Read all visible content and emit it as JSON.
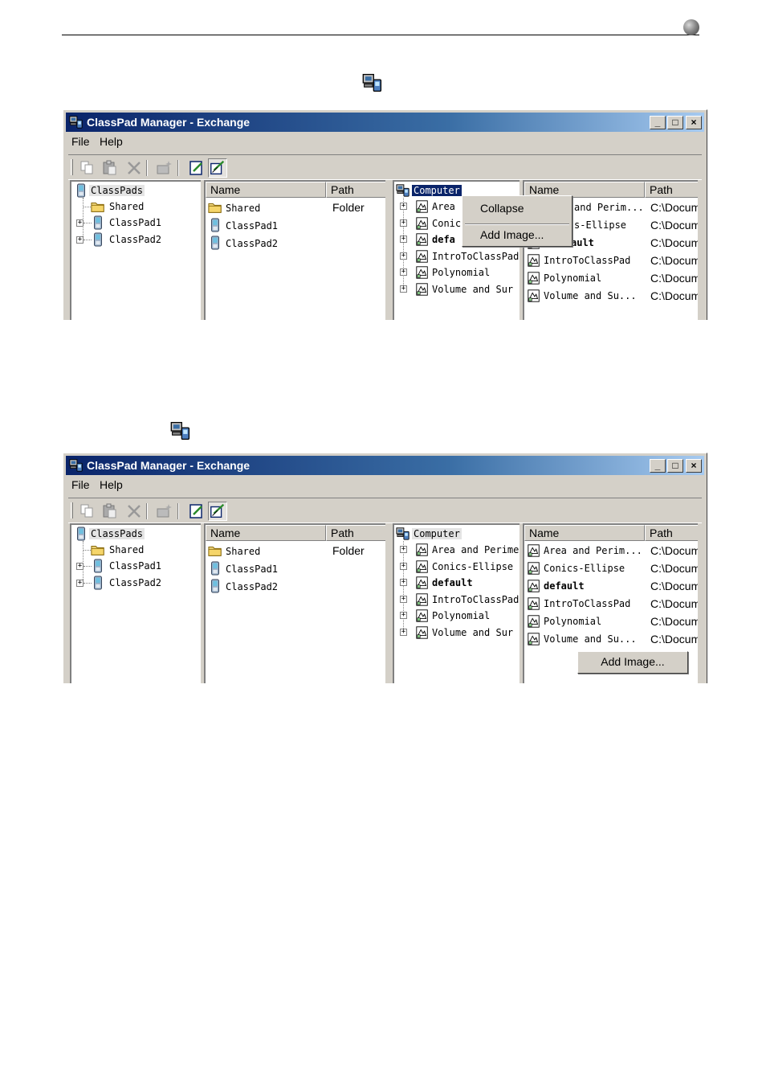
{
  "window": {
    "title": "ClassPad Manager - Exchange",
    "menu": [
      "File",
      "Help"
    ],
    "controls": {
      "minimize": "_",
      "maximize": "□",
      "close": "×"
    }
  },
  "left_tree": {
    "root": "ClassPads",
    "children": [
      "Shared",
      "ClassPad1",
      "ClassPad2"
    ]
  },
  "classpad_list": {
    "columns": [
      "Name",
      "Path"
    ],
    "rows": [
      {
        "name": "Shared",
        "path": "Folder"
      },
      {
        "name": "ClassPad1",
        "path": ""
      },
      {
        "name": "ClassPad2",
        "path": ""
      }
    ]
  },
  "computer_tree": {
    "root": "Computer",
    "items_w1": [
      "Area",
      "Conic:",
      "defa",
      "IntroToClassPad",
      "Polynomial",
      "Volume and Sur"
    ],
    "items_w2": [
      "Area and Perime",
      "Conics-Ellipse",
      "default",
      "IntroToClassPad",
      "Polynomial",
      "Volume and Sur"
    ]
  },
  "computer_list": {
    "columns": [
      "Name",
      "Path"
    ],
    "rows_w1": [
      {
        "name": "and Perim...",
        "path": "C:\\Docum"
      },
      {
        "name": "s-Ellipse",
        "path": "C:\\Docum"
      },
      {
        "name": "ault",
        "path": "C:\\Docum"
      },
      {
        "name": "IntroToClassPad",
        "path": "C:\\Docum"
      },
      {
        "name": "Polynomial",
        "path": "C:\\Docum"
      },
      {
        "name": "Volume and Su...",
        "path": "C:\\Docum"
      }
    ],
    "rows_w2": [
      {
        "name": "Area and Perim...",
        "path": "C:\\Docum"
      },
      {
        "name": "Conics-Ellipse",
        "path": "C:\\Docum"
      },
      {
        "name": "default",
        "path": "C:\\Docum"
      },
      {
        "name": "IntroToClassPad",
        "path": "C:\\Docum"
      },
      {
        "name": "Polynomial",
        "path": "C:\\Docum"
      },
      {
        "name": "Volume and Su...",
        "path": "C:\\Docum"
      }
    ]
  },
  "context_menu": {
    "items": [
      "Collapse",
      "Add Image..."
    ]
  },
  "add_image_button": "Add Image...",
  "colors": {
    "title_start": "#0a246a",
    "title_end": "#a6caf0",
    "face": "#d4d0c8",
    "selection": "#0a246a"
  }
}
